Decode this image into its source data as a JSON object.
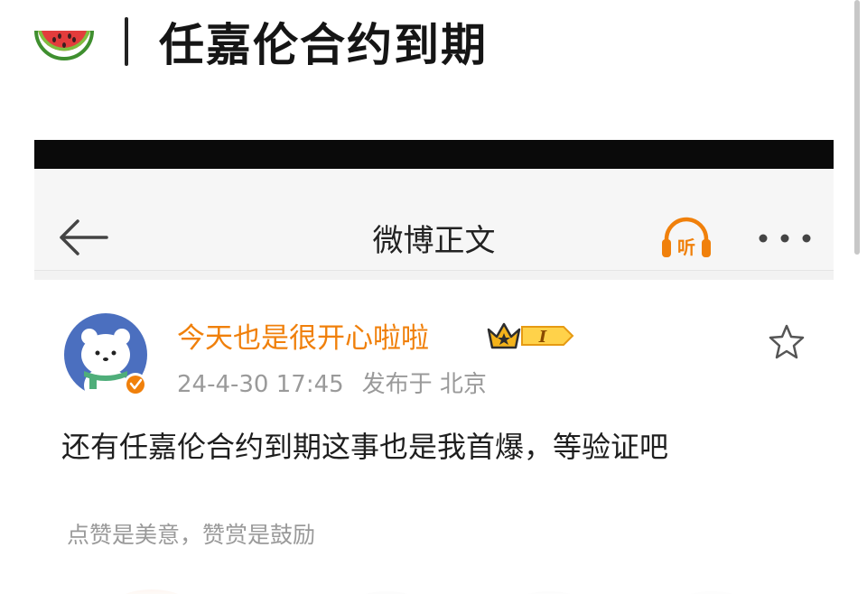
{
  "header": {
    "emoji_icon": "watermelon-icon",
    "title": "任嘉伦合约到期"
  },
  "weibo": {
    "nav": {
      "title": "微博正文",
      "listen_label": "听",
      "icons": [
        "back-arrow-icon",
        "listen-headphone-icon",
        "more-icon"
      ]
    },
    "post": {
      "user_name": "今天也是很开心啦啦",
      "level_badge": "I",
      "time": "24-4-30 17:45",
      "location": "发布于 北京",
      "text": "还有任嘉伦合约到期这事也是我首爆，等验证吧",
      "reward_hint": "点赞是美意，赞赏是鼓励"
    }
  },
  "colors": {
    "accent": "#f0800b",
    "status_bar": "#0a0a0a",
    "nav_bg": "#f6f6f6",
    "text_primary": "#1e1e1e",
    "text_secondary": "#9a9a9a",
    "avatar_bg": "#4b6fbf"
  }
}
